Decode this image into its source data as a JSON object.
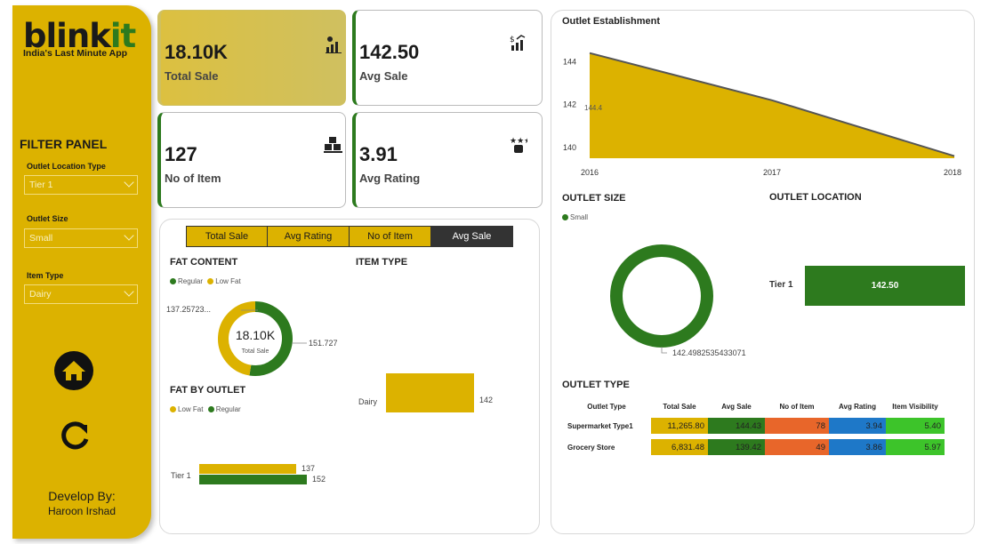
{
  "brand": {
    "name_part1": "blink",
    "name_part2": "it",
    "tagline": "India's Last Minute App"
  },
  "filters": {
    "title": "FILTER PANEL",
    "items": [
      {
        "label": "Outlet Location Type",
        "value": "Tier 1"
      },
      {
        "label": "Outlet Size",
        "value": "Small"
      },
      {
        "label": "Item Type",
        "value": "Dairy"
      }
    ]
  },
  "nav": {
    "home_icon": "home-icon",
    "reset_icon": "refresh-icon"
  },
  "developer": {
    "line1": "Develop By:",
    "line2": "Haroon Irshad"
  },
  "kpis": {
    "total_sale": {
      "value": "18.10K",
      "label": "Total Sale"
    },
    "avg_sale": {
      "value": "142.50",
      "label": "Avg Sale"
    },
    "no_of_item": {
      "value": "127",
      "label": "No of Item"
    },
    "avg_rating": {
      "value": "3.91",
      "label": "Avg Rating"
    }
  },
  "measure_buttons": [
    "Total Sale",
    "Avg Rating",
    "No of Item",
    "Avg Sale"
  ],
  "fat_content": {
    "title": "FAT CONTENT",
    "legend": [
      "Regular",
      "Low Fat"
    ],
    "center_value": "18.10K",
    "center_label": "Total Sale",
    "label_left": "137.25723...",
    "label_right": "151.727"
  },
  "item_type": {
    "title": "ITEM TYPE",
    "category": "Dairy",
    "value": "142"
  },
  "fat_by_outlet": {
    "title": "FAT BY OUTLET",
    "legend": [
      "Low Fat",
      "Regular"
    ],
    "category": "Tier 1",
    "value_low": "137",
    "value_regular": "152"
  },
  "outlet_establishment": {
    "title": "Outlet Establishment",
    "point_label": "144.4"
  },
  "outlet_size": {
    "title": "OUTLET SIZE",
    "legend": "Small",
    "value_label": "142.4982535433071"
  },
  "outlet_location": {
    "title": "OUTLET LOCATION",
    "category": "Tier 1",
    "value": "142.50"
  },
  "outlet_type": {
    "title": "OUTLET TYPE",
    "headers": [
      "Outlet Type",
      "Total Sale",
      "Avg Sale",
      "No of Item",
      "Avg Rating",
      "Item Visibility"
    ],
    "rows": [
      [
        "Supermarket Type1",
        "11,265.80",
        "144.43",
        "78",
        "3.94",
        "5.40"
      ],
      [
        "Grocery Store",
        "6,831.48",
        "139.42",
        "49",
        "3.86",
        "5.97"
      ]
    ]
  },
  "colors": {
    "yellow": "#dcb200",
    "green": "#2d7a1e",
    "orange": "#e8662a",
    "blue": "#1e78c8",
    "lime": "#3dc42a"
  },
  "chart_data": [
    {
      "type": "area",
      "title": "Outlet Establishment",
      "x": [
        2016,
        2017,
        2018
      ],
      "y": [
        144.4,
        142.2,
        139.6
      ],
      "ylim": [
        139.5,
        144.8
      ],
      "yticks": [
        140,
        142,
        144
      ],
      "xlabel": "",
      "ylabel": "",
      "data_labels": [
        "144.4"
      ]
    },
    {
      "type": "pie",
      "title": "FAT CONTENT",
      "labels": [
        "Regular",
        "Low Fat"
      ],
      "values": [
        151.727,
        137.25723
      ],
      "center": "18.10K"
    },
    {
      "type": "pie",
      "title": "OUTLET SIZE",
      "labels": [
        "Small"
      ],
      "values": [
        142.4982535433071
      ]
    },
    {
      "type": "bar",
      "title": "ITEM TYPE",
      "categories": [
        "Dairy"
      ],
      "values": [
        142
      ]
    },
    {
      "type": "bar",
      "title": "FAT BY OUTLET",
      "categories": [
        "Tier 1"
      ],
      "series": [
        {
          "name": "Low Fat",
          "values": [
            137
          ]
        },
        {
          "name": "Regular",
          "values": [
            152
          ]
        }
      ]
    },
    {
      "type": "bar",
      "title": "OUTLET LOCATION",
      "categories": [
        "Tier 1"
      ],
      "values": [
        142.5
      ]
    }
  ]
}
